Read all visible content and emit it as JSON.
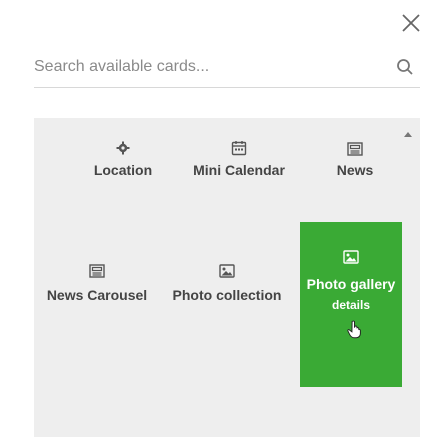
{
  "search": {
    "placeholder": "Search available cards..."
  },
  "cards": [
    {
      "label": "Location",
      "icon": "gear-icon"
    },
    {
      "label": "Mini Calendar",
      "icon": "calendar-icon"
    },
    {
      "label": "News",
      "icon": "newspaper-icon"
    },
    {
      "label": "News Carousel",
      "icon": "newspaper-icon"
    },
    {
      "label": "Photo collection",
      "icon": "photo-icon"
    },
    {
      "label": "Photo gallery",
      "icon": "photo-icon",
      "selected": true,
      "details_label": "details"
    }
  ],
  "colors": {
    "accent": "#3aaa35",
    "panel": "#eeeeee",
    "text": "#444444"
  }
}
